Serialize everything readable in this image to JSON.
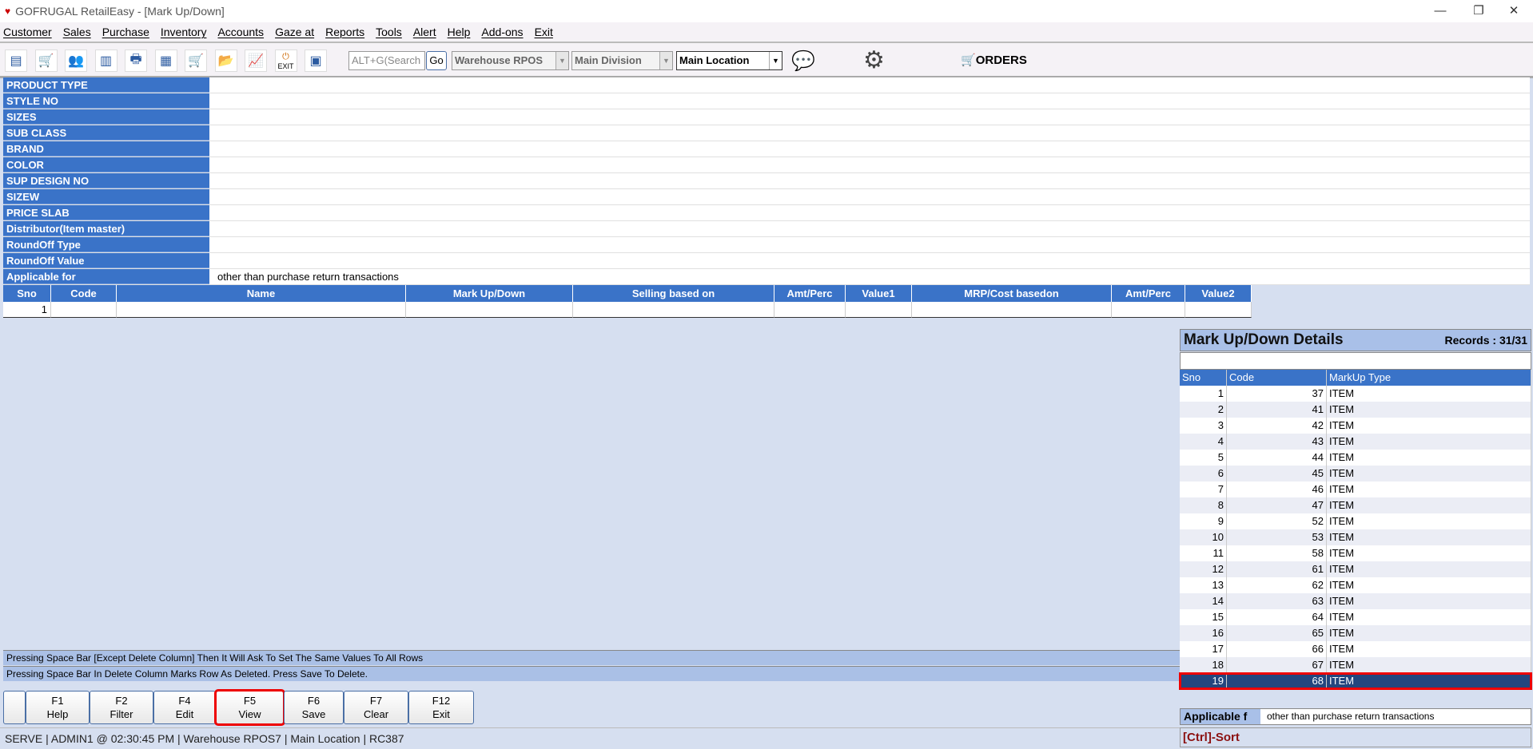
{
  "window": {
    "title": "GOFRUGAL RetailEasy - [Mark Up/Down]",
    "logo": "RE"
  },
  "menu": [
    "Customer",
    "Sales",
    "Purchase",
    "Inventory",
    "Accounts",
    "Gaze at",
    "Reports",
    "Tools",
    "Alert",
    "Help",
    "Add-ons",
    "Exit"
  ],
  "toolbar": {
    "icons": [
      "customer-icon",
      "sales-cart-icon",
      "users-icon",
      "barcode-icon",
      "print-icon",
      "document-icon",
      "purchase-cart-icon",
      "folder-icon",
      "chart-icon",
      "exit-icon",
      "report-icon"
    ],
    "exit_label": "EXIT",
    "search_placeholder": "ALT+G(Search",
    "go_label": "Go",
    "warehouse": "Warehouse RPOS",
    "division": "Main Division",
    "location": "Main Location",
    "orders_label": "ORDERS"
  },
  "filters": [
    {
      "label": "PRODUCT TYPE",
      "value": ""
    },
    {
      "label": "STYLE NO",
      "value": ""
    },
    {
      "label": "SIZES",
      "value": ""
    },
    {
      "label": "SUB CLASS",
      "value": ""
    },
    {
      "label": "BRAND",
      "value": ""
    },
    {
      "label": "COLOR",
      "value": ""
    },
    {
      "label": "SUP DESIGN NO",
      "value": ""
    },
    {
      "label": "SIZEW",
      "value": ""
    },
    {
      "label": "PRICE SLAB",
      "value": ""
    },
    {
      "label": "Distributor(Item master)",
      "value": ""
    },
    {
      "label": "RoundOff Type",
      "value": ""
    },
    {
      "label": "RoundOff Value",
      "value": ""
    },
    {
      "label": "Applicable for",
      "value": "other than purchase return transactions"
    }
  ],
  "grid": {
    "columns": [
      "Sno",
      "Code",
      "Name",
      "Mark Up/Down",
      "Selling based on",
      "Amt/Perc",
      "Value1",
      "MRP/Cost basedon",
      "Amt/Perc",
      "Value2"
    ],
    "rows": [
      [
        "1",
        "",
        "",
        "",
        "",
        "",
        "",
        "",
        "",
        ""
      ]
    ]
  },
  "hints": [
    "Pressing Space Bar [Except Delete Column] Then It Will Ask To Set The Same Values To All Rows",
    "Pressing Space Bar In Delete Column Marks Row As Deleted. Press Save To Delete."
  ],
  "fkeys": [
    {
      "key": "F1",
      "label": "Help"
    },
    {
      "key": "F2",
      "label": "Filter"
    },
    {
      "key": "F4",
      "label": "Edit"
    },
    {
      "key": "F5",
      "label": "View"
    },
    {
      "key": "F6",
      "label": "Save"
    },
    {
      "key": "F7",
      "label": "Clear"
    },
    {
      "key": "F12",
      "label": "Exit"
    }
  ],
  "status": "SERVE | ADMIN1  @ 02:30:45 PM   | Warehouse RPOS7   | Main Location | RC387",
  "panel": {
    "title": "Mark Up/Down Details",
    "records": "Records : 31/31",
    "columns": [
      "Sno",
      "Code",
      "MarkUp Type"
    ],
    "rows": [
      [
        "1",
        "37",
        "ITEM"
      ],
      [
        "2",
        "41",
        "ITEM"
      ],
      [
        "3",
        "42",
        "ITEM"
      ],
      [
        "4",
        "43",
        "ITEM"
      ],
      [
        "5",
        "44",
        "ITEM"
      ],
      [
        "6",
        "45",
        "ITEM"
      ],
      [
        "7",
        "46",
        "ITEM"
      ],
      [
        "8",
        "47",
        "ITEM"
      ],
      [
        "9",
        "52",
        "ITEM"
      ],
      [
        "10",
        "53",
        "ITEM"
      ],
      [
        "11",
        "58",
        "ITEM"
      ],
      [
        "12",
        "61",
        "ITEM"
      ],
      [
        "13",
        "62",
        "ITEM"
      ],
      [
        "14",
        "63",
        "ITEM"
      ],
      [
        "15",
        "64",
        "ITEM"
      ],
      [
        "16",
        "65",
        "ITEM"
      ],
      [
        "17",
        "66",
        "ITEM"
      ],
      [
        "18",
        "67",
        "ITEM"
      ],
      [
        "19",
        "68",
        "ITEM"
      ]
    ],
    "selected_row": 19,
    "applicable_label": "Applicable f",
    "applicable_value": "other than purchase return transactions",
    "sort_hint": "[Ctrl]-Sort"
  }
}
